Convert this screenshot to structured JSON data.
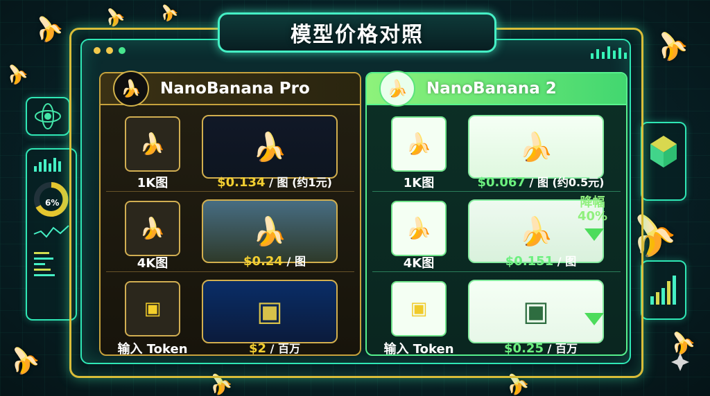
{
  "header": {
    "title": "模型价格对照"
  },
  "colors": {
    "gold": "#f3cf31",
    "green": "#6cf07f",
    "cyan": "#2fe7b5"
  },
  "icons": {
    "banana": "banana-icon",
    "chip": "chip-icon"
  },
  "left_widget": {
    "gauge": "6%"
  },
  "discount": {
    "line1": "降幅",
    "line2": "40%"
  },
  "models": [
    {
      "name": "NanoBanana Pro",
      "rows": [
        {
          "label": "1K图",
          "price": "$0.134",
          "suffix": " / 图 (约1元)"
        },
        {
          "label": "4K图",
          "price": "$0.24",
          "suffix": " / 图"
        },
        {
          "label": "输入 Token",
          "price": "$2",
          "suffix": " / 百万"
        }
      ]
    },
    {
      "name": "NanoBanana 2",
      "rows": [
        {
          "label": "1K图",
          "price": "$0.067",
          "suffix": " / 图 (约0.5元)"
        },
        {
          "label": "4K图",
          "price": "$0.151",
          "suffix": " / 图"
        },
        {
          "label": "输入 Token",
          "price": "$0.25",
          "suffix": " / 百万"
        }
      ]
    }
  ]
}
